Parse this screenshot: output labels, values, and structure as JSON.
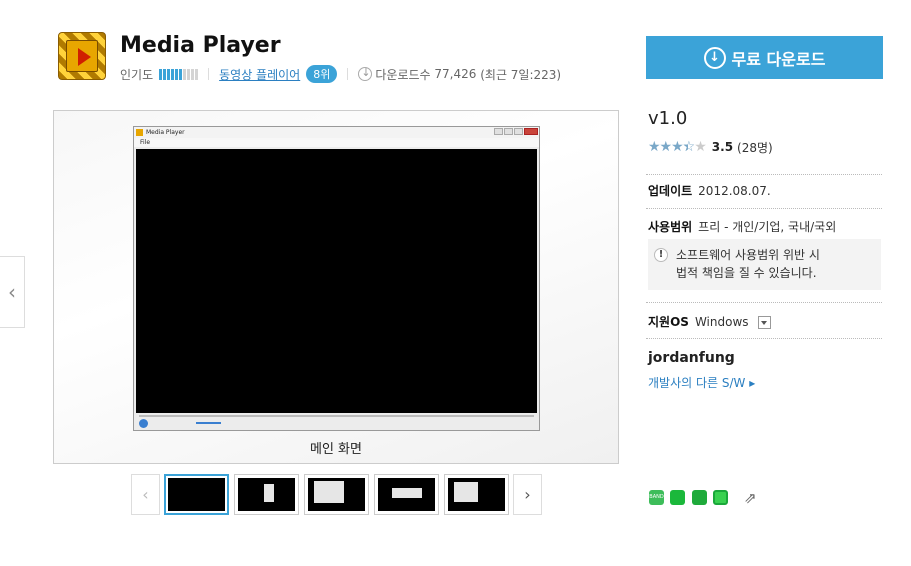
{
  "app": {
    "title": "Media Player",
    "popularity_label": "인기도",
    "popularity_level": 0.6,
    "category": "동영상 플레이어",
    "rank": "8위",
    "downloads_label": "다운로드수",
    "downloads": "77,426",
    "downloads_recent": "(최근 7일:223)"
  },
  "download_button": {
    "label": "무료 다운로드"
  },
  "screenshot": {
    "caption": "메인 화면",
    "window_title": "Media Player",
    "window_menu": "File"
  },
  "info": {
    "version": "v1.0",
    "rating_value": "3.5",
    "rating_count": "(28명)",
    "rating_stars": 3.5,
    "update_label": "업데이트",
    "update_date": "2012.08.07.",
    "license_label": "사용범위",
    "license_value": "프리 - 개인/기업, 국내/국외",
    "notice_line1": "소프트웨어 사용범위 위반 시",
    "notice_line2": "법적 책임을 질 수 있습니다.",
    "os_label": "지원OS",
    "os_value": "Windows",
    "developer": "jordanfung",
    "developer_link": "개발사의 다른 S/W ▸"
  },
  "share": {
    "band_text": "BAND"
  },
  "colors": {
    "accent": "#3ba3d8",
    "link": "#2b7fc1"
  },
  "icons": [
    "media-player-app-icon",
    "download-circle-icon",
    "chevron-left-icon",
    "chevron-right-icon",
    "exclamation-icon",
    "dropdown-arrow-icon",
    "share-icon"
  ]
}
